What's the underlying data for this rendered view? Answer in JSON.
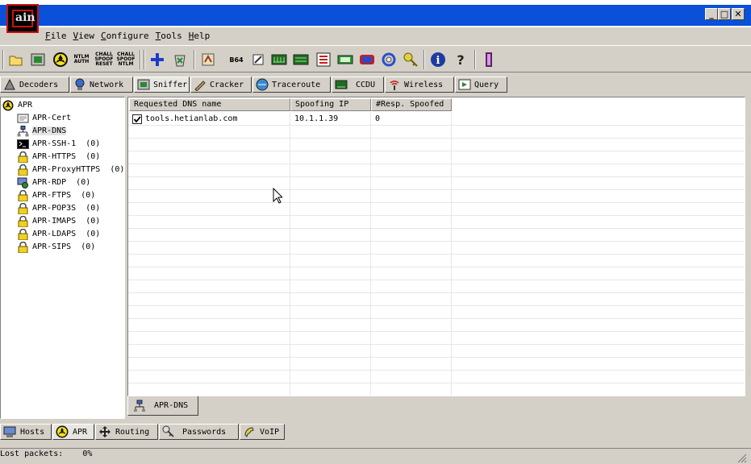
{
  "window": {
    "logo_text": "ain",
    "buttons": {
      "minimize": "_",
      "maximize": "□",
      "close": "✕"
    }
  },
  "menu": [
    "File",
    "View",
    "Configure",
    "Tools",
    "Help"
  ],
  "toolbar": {
    "icons": [
      "open-folder-icon",
      "start-sniffer-icon",
      "start-apr-icon",
      "ntlm-auth-icon",
      "chall-spoof-reset-icon",
      "chall-spoof-ntlm-icon",
      "add-icon",
      "remove-icon",
      "decode-icon",
      "base64-icon",
      "pwd-tool-icon",
      "lsa-icon",
      "vnc-icon",
      "hash-calc-icon",
      "cisco-icon",
      "box-icon",
      "ring-icon",
      "network-icon",
      "key-icon",
      "info-icon",
      "help-icon",
      "exit-icon"
    ],
    "ntlm_label": "NTLM AUTH",
    "chall1_label": "CHALL SPOOF RESET",
    "chall2_label": "CHALL SPOOF NTLM",
    "b64_label": "B64"
  },
  "tabs": [
    {
      "label": "Decoders",
      "icon": "decoders-icon"
    },
    {
      "label": "Network",
      "icon": "network-icon"
    },
    {
      "label": "Sniffer",
      "icon": "sniffer-icon",
      "selected": true
    },
    {
      "label": "Cracker",
      "icon": "cracker-icon"
    },
    {
      "label": "Traceroute",
      "icon": "traceroute-icon"
    },
    {
      "label": "CCDU",
      "icon": "ccdu-icon"
    },
    {
      "label": "Wireless",
      "icon": "wireless-icon"
    },
    {
      "label": "Query",
      "icon": "query-icon"
    }
  ],
  "tree": {
    "root": "APR",
    "items": [
      {
        "label": "APR-Cert",
        "icon": "certificate-icon"
      },
      {
        "label": "APR-DNS",
        "icon": "dns-icon",
        "selected": true
      },
      {
        "label": "APR-SSH-1  (0)",
        "icon": "terminal-icon"
      },
      {
        "label": "APR-HTTPS  (0)",
        "icon": "lock-icon"
      },
      {
        "label": "APR-ProxyHTTPS  (0)",
        "icon": "lock-icon"
      },
      {
        "label": "APR-RDP  (0)",
        "icon": "remote-desktop-icon"
      },
      {
        "label": "APR-FTPS  (0)",
        "icon": "lock-icon"
      },
      {
        "label": "APR-POP3S  (0)",
        "icon": "lock-icon"
      },
      {
        "label": "APR-IMAPS  (0)",
        "icon": "lock-icon"
      },
      {
        "label": "APR-LDAPS  (0)",
        "icon": "lock-icon"
      },
      {
        "label": "APR-SIPS  (0)",
        "icon": "lock-icon"
      }
    ]
  },
  "table": {
    "columns": [
      "Requested DNS name",
      "Spoofing IP",
      "#Resp. Spoofed"
    ],
    "rows": [
      {
        "checked": true,
        "name": "tools.hetianlab.com",
        "ip": "10.1.1.39",
        "count": "0"
      }
    ]
  },
  "subtab": {
    "label": "APR-DNS"
  },
  "bottom_tabs": [
    {
      "label": "Hosts",
      "icon": "hosts-icon"
    },
    {
      "label": "APR",
      "icon": "apr-icon",
      "selected": true
    },
    {
      "label": "Routing",
      "icon": "routing-icon"
    },
    {
      "label": "Passwords",
      "icon": "passwords-icon"
    },
    {
      "label": "VoIP",
      "icon": "voip-icon"
    }
  ],
  "status": {
    "text": "Lost packets:    0%"
  },
  "colors": {
    "titlebar": "#0a50d8",
    "logo_border": "#cc1010",
    "face": "#d4d0c8"
  }
}
